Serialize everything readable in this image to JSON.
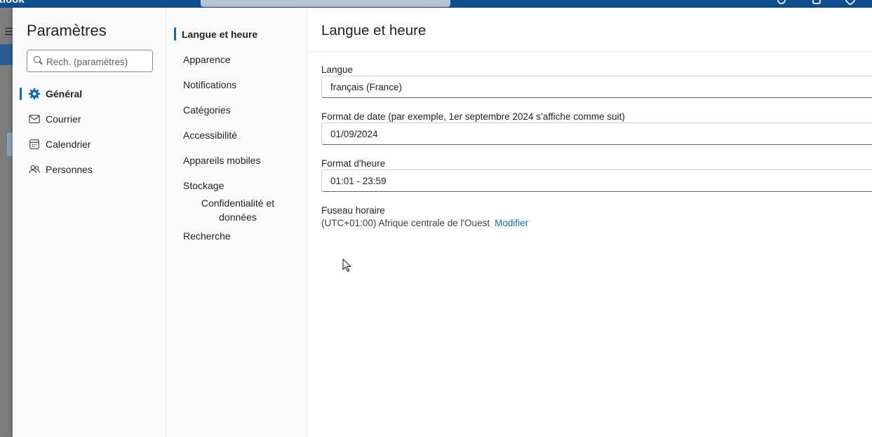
{
  "app": {
    "name": "Outlook"
  },
  "settings": {
    "title": "Paramètres",
    "search_placeholder": "Rech. (paramètres)",
    "categories": [
      {
        "label": "Général",
        "icon": "gear-icon",
        "active": true
      },
      {
        "label": "Courrier",
        "icon": "mail-icon",
        "active": false
      },
      {
        "label": "Calendrier",
        "icon": "calendar-icon",
        "active": false
      },
      {
        "label": "Personnes",
        "icon": "people-icon",
        "active": false
      }
    ],
    "subnav": [
      {
        "label": "Langue et heure",
        "active": true
      },
      {
        "label": "Apparence"
      },
      {
        "label": "Notifications"
      },
      {
        "label": "Catégories"
      },
      {
        "label": "Accessibilité"
      },
      {
        "label": "Appareils mobiles"
      },
      {
        "label": "Stockage"
      },
      {
        "label": "Confidentialité et données"
      },
      {
        "label": "Recherche"
      }
    ]
  },
  "content": {
    "title": "Langue et heure",
    "language": {
      "label": "Langue",
      "value": "français (France)"
    },
    "date_format": {
      "label": "Format de date (par exemple, 1er septembre 2024 s’affiche comme suit)",
      "value": "01/09/2024"
    },
    "time_format": {
      "label": "Format d'heure",
      "value": "01:01 - 23:59"
    },
    "timezone": {
      "label": "Fuseau horaire",
      "value": "(UTC+01:00) Afrique centrale de l'Ouest",
      "action": "Modifier"
    }
  },
  "colors": {
    "accent": "#0f6cbd",
    "topbar": "#0f4f8f"
  }
}
